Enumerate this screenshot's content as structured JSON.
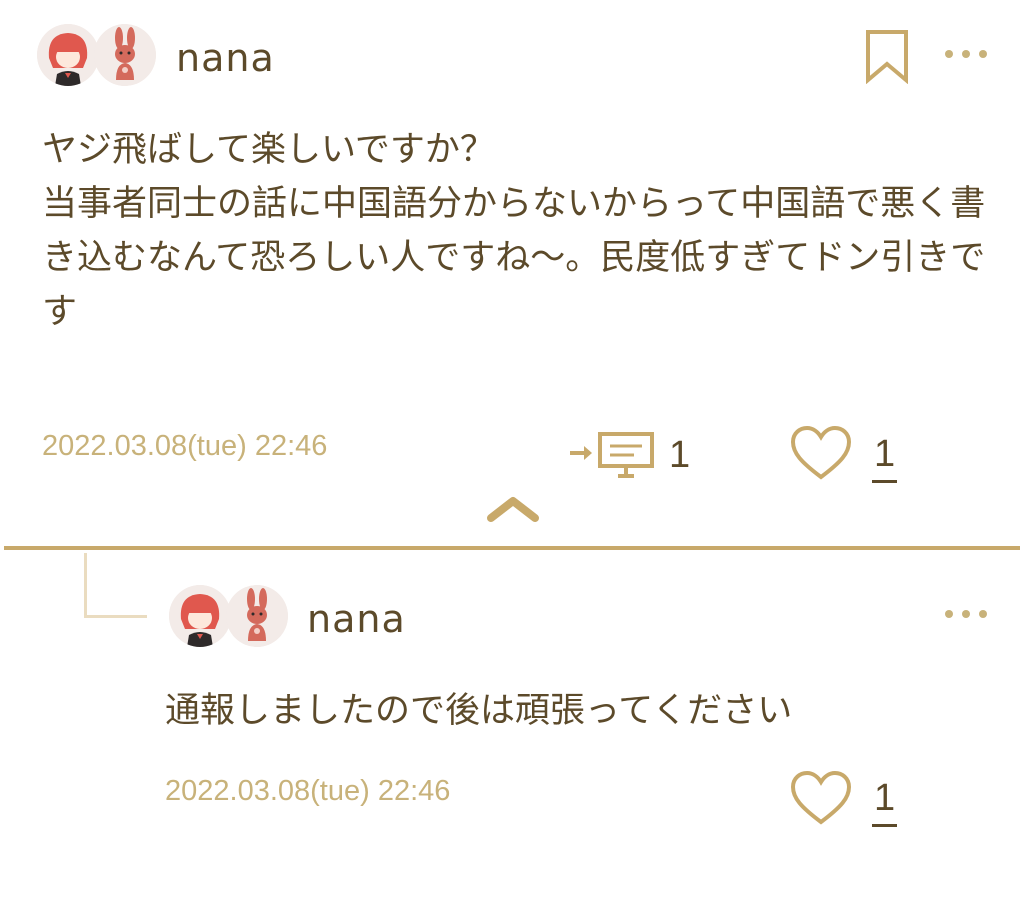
{
  "post": {
    "username": "nana",
    "text": "ヤジ飛ばして楽しいですか？\n当事者同士の話に中国語分からないからって中国語で悪く書き込むなんて恐ろしい人ですね〜。民度低すぎてドン引きです",
    "timestamp": "2022.03.08(tue) 22:46",
    "reply_count": "1",
    "like_count": "1"
  },
  "reply": {
    "username": "nana",
    "text": "通報しましたので後は頑張ってください",
    "timestamp": "2022.03.08(tue) 22:46",
    "like_count": "1"
  },
  "icons": {
    "bookmark": "bookmark-icon",
    "more": "more-icon",
    "reply": "reply-icon",
    "heart": "heart-icon",
    "collapse": "chevron-up-icon",
    "reply_connector": "reply-connector-line"
  },
  "colors": {
    "accent_gold": "#c8a96a",
    "text_brown": "#5c4a2a",
    "timestamp_gold": "#c8b27a"
  }
}
